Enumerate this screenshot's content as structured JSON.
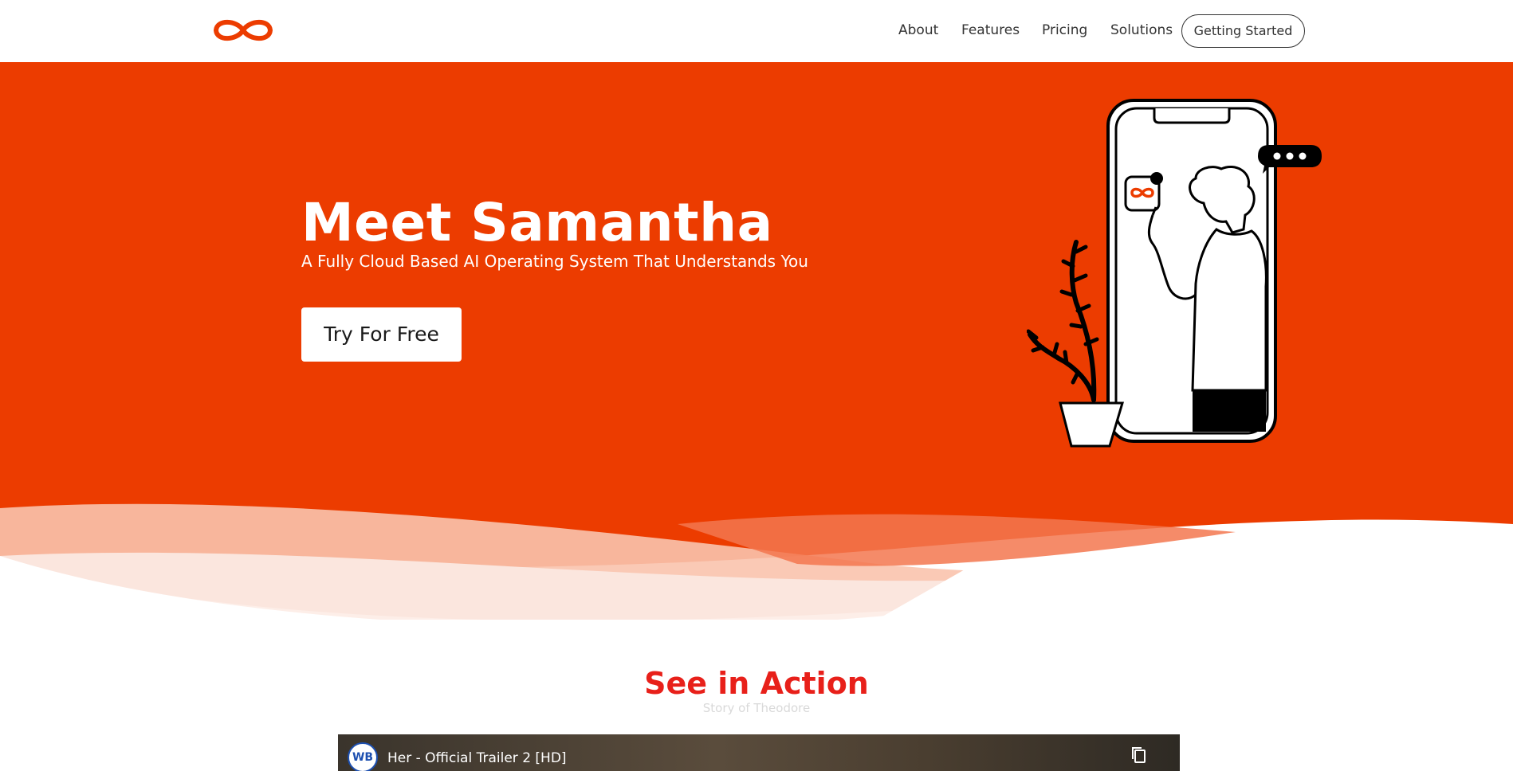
{
  "nav": {
    "links": [
      {
        "label": "About"
      },
      {
        "label": "Features"
      },
      {
        "label": "Pricing"
      },
      {
        "label": "Solutions"
      }
    ],
    "cta_label": "Getting Started",
    "logo_icon": "infinity-icon"
  },
  "hero": {
    "title": "Meet Samantha",
    "subtitle": "A Fully Cloud Based AI Operating System That Understands You",
    "cta_label": "Try For Free",
    "illustration": "phone-person-plant-illustration"
  },
  "section": {
    "title": "See in Action",
    "subtitle": "Story of Theodore"
  },
  "video": {
    "title": "Her - Official Trailer 2 [HD]",
    "channel_badge": "WB",
    "icons": [
      "channel-avatar-icon",
      "copy-link-icon"
    ]
  },
  "colors": {
    "brand": "#ec3c00",
    "accent_red": "#e8201a",
    "white": "#ffffff"
  }
}
